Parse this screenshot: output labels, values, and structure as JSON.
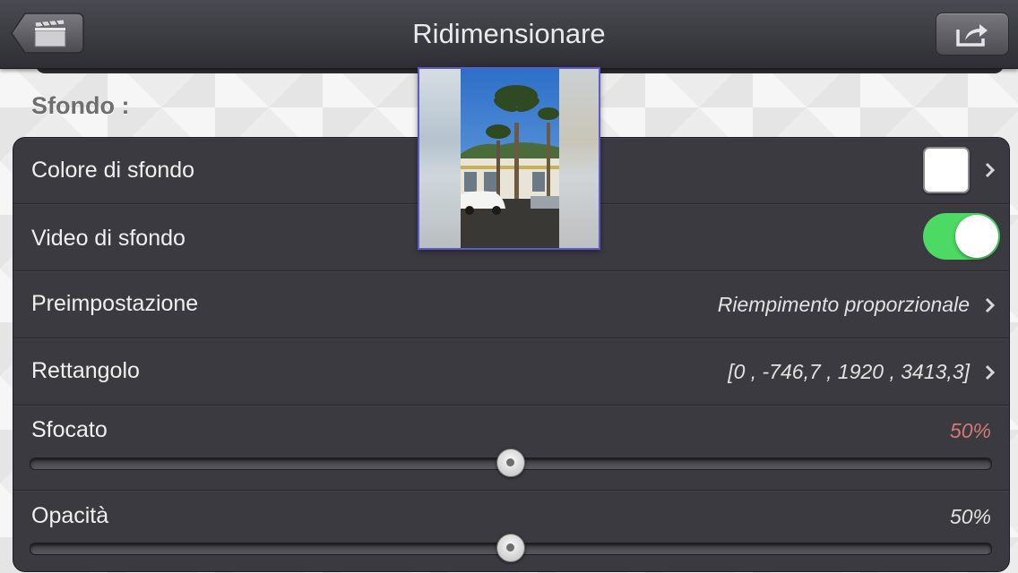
{
  "navbar": {
    "title": "Ridimensionare",
    "back_icon": "clapperboard-back-icon",
    "share_icon": "share-arrow-icon"
  },
  "section": {
    "header": "Sfondo :"
  },
  "rows": {
    "background_color": {
      "label": "Colore di sfondo",
      "swatch_color": "#ffffff"
    },
    "background_video": {
      "label": "Video di sfondo",
      "enabled": true,
      "toggle_color": "#4cd964"
    },
    "preset": {
      "label": "Preimpostazione",
      "value": "Riempimento proporzionale"
    },
    "rectangle": {
      "label": "Rettangolo",
      "value": "[0 , -746,7 , 1920 , 3413,3]"
    },
    "blur": {
      "label": "Sfocato",
      "value": "50%",
      "value_color": "#d37a73",
      "level": 0.5
    },
    "opacity": {
      "label": "Opacità",
      "value": "50%",
      "level": 0.5
    }
  },
  "preview": {
    "description_icon": "video-frame-thumbnail",
    "border_color": "#5b5bcc"
  }
}
